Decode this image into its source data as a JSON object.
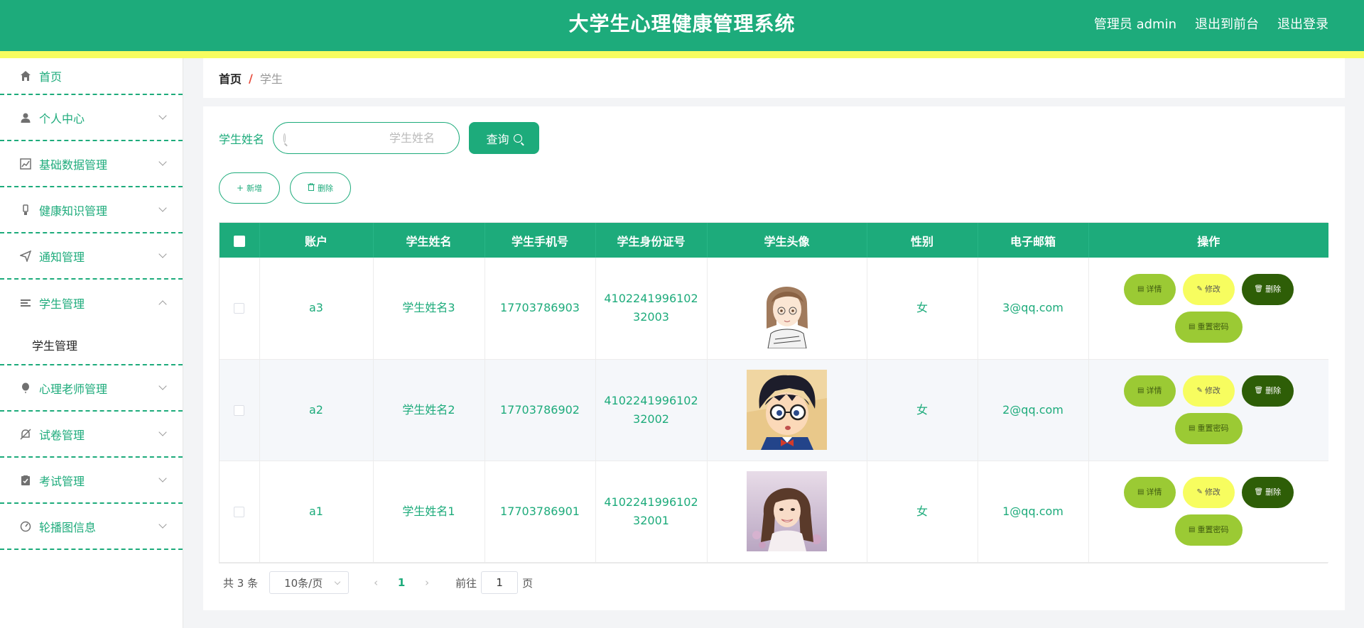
{
  "header": {
    "title": "大学生心理健康管理系统",
    "role": "管理员 admin",
    "front_link": "退出到前台",
    "logout_link": "退出登录"
  },
  "sidebar": {
    "items": [
      {
        "label": "首页",
        "icon": "home-icon"
      },
      {
        "label": "个人中心",
        "icon": "user-icon"
      },
      {
        "label": "基础数据管理",
        "icon": "chart-icon"
      },
      {
        "label": "健康知识管理",
        "icon": "bulb-icon"
      },
      {
        "label": "通知管理",
        "icon": "send-icon"
      },
      {
        "label": "学生管理",
        "icon": "list-icon"
      },
      {
        "label": "心理老师管理",
        "icon": "balloon-icon"
      },
      {
        "label": "试卷管理",
        "icon": "bell-off-icon"
      },
      {
        "label": "考试管理",
        "icon": "clipboard-icon"
      },
      {
        "label": "轮播图信息",
        "icon": "gauge-icon"
      }
    ],
    "submenu": {
      "label": "学生管理"
    }
  },
  "breadcrumb": {
    "home": "首页",
    "sep": "/",
    "current": "学生"
  },
  "search": {
    "label": "学生姓名",
    "placeholder": "学生姓名",
    "value": "",
    "button": "查询"
  },
  "actions": {
    "add": "新增",
    "delete": "删除"
  },
  "table": {
    "headers": [
      "账户",
      "学生姓名",
      "学生手机号",
      "学生身份证号",
      "学生头像",
      "性别",
      "电子邮箱",
      "操作"
    ],
    "rows": [
      {
        "account": "a3",
        "name": "学生姓名3",
        "phone": "17703786903",
        "idcard": "410224199610232003",
        "avatar": "girl-sketch",
        "gender": "女",
        "email": "3@qq.com"
      },
      {
        "account": "a2",
        "name": "学生姓名2",
        "phone": "17703786902",
        "idcard": "410224199610232002",
        "avatar": "cartoon-boy",
        "gender": "女",
        "email": "2@qq.com"
      },
      {
        "account": "a1",
        "name": "学生姓名1",
        "phone": "17703786901",
        "idcard": "410224199610232001",
        "avatar": "girl-photo",
        "gender": "女",
        "email": "1@qq.com"
      }
    ],
    "ops": {
      "detail": "详情",
      "edit": "修改",
      "delete": "删除",
      "reset": "重置密码"
    }
  },
  "pagination": {
    "total": "共 3 条",
    "page_size": "10条/页",
    "current_page": "1",
    "goto_label": "前往",
    "goto_value": "1",
    "page_suffix": "页"
  },
  "colors": {
    "primary": "#1dab7b",
    "accent_yellow": "#f7fd5f",
    "lime": "#9bca34",
    "dark_green": "#2e5e07"
  }
}
